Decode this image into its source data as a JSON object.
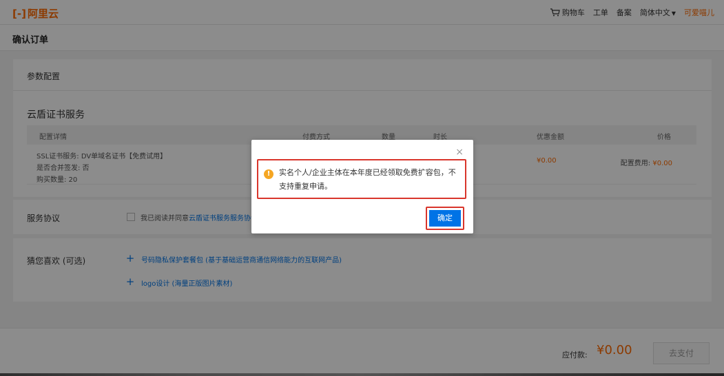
{
  "brand": {
    "logo_mark": "[-]",
    "logo_text": "阿里云"
  },
  "topnav": {
    "cart": "购物车",
    "ticket": "工单",
    "filing": "备案",
    "language": "简体中文",
    "user": "可爱喵儿"
  },
  "page": {
    "title": "确认订单"
  },
  "config": {
    "header": "参数配置",
    "service_title": "云盾证书服务",
    "columns": [
      "配置详情",
      "付费方式",
      "数量",
      "时长",
      "优惠金额",
      "价格"
    ],
    "row": {
      "detail_lines": [
        "SSL证书服务: DV单域名证书【免费试用】",
        "是否合并签发: 否",
        "购买数量: 20"
      ],
      "discount": "¥0.00",
      "price_label": "配置费用:",
      "price_value": "¥0.00"
    }
  },
  "agreement": {
    "label": "服务协议",
    "agree_text": "我已阅读并同意",
    "link_text": "云盾证书服务服务协议"
  },
  "recommend": {
    "label": "猜您喜欢 (可选)",
    "items": [
      {
        "text": "号码隐私保护套餐包 (基于基础运营商通信网络能力的互联网产品)"
      },
      {
        "text": "logo设计 (海量正版图片素材)"
      }
    ]
  },
  "footer": {
    "due_label": "应付款:",
    "due_amount": "¥0.00",
    "pay_button": "去支付"
  },
  "dialog": {
    "message": "实名个人/企业主体在本年度已经领取免费扩容包，不支持重复申请。",
    "ok_button": "确定",
    "close_glyph": "×",
    "icon_glyph": "!"
  },
  "colors": {
    "accent": "#ff6a00",
    "primary": "#0073e6",
    "highlight": "#d9352b",
    "warning": "#f5a623"
  }
}
